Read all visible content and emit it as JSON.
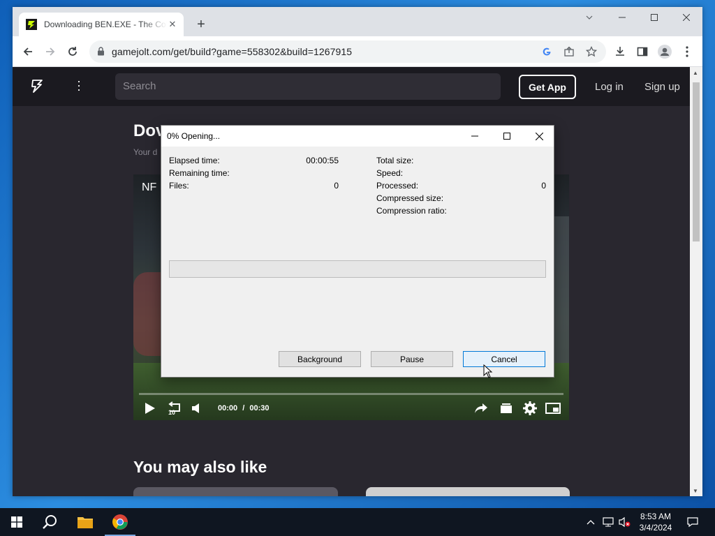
{
  "browser": {
    "tab_title": "Downloading BEN.EXE - The Coll",
    "url": "gamejolt.com/get/build?game=558302&build=1267915"
  },
  "site": {
    "search_placeholder": "Search",
    "get_app": "Get App",
    "log_in": "Log in",
    "sign_up": "Sign up",
    "heading": "Dov",
    "subheading": "Your d",
    "video_overlay_text": "NF",
    "video_time_current": "00:00",
    "video_time_sep": "/",
    "video_time_total": "00:30",
    "rewind_seconds": "10",
    "also_like": "You may also like"
  },
  "dialog": {
    "title": "0% Opening...",
    "left_labels": [
      "Elapsed time:",
      "Remaining time:",
      "Files:"
    ],
    "left_values": [
      "00:00:55",
      "",
      "0"
    ],
    "right_labels": [
      "Total size:",
      "Speed:",
      "Processed:",
      "Compressed size:",
      "Compression ratio:"
    ],
    "right_values": [
      "",
      "",
      "0",
      "",
      ""
    ],
    "progress": 0,
    "buttons": {
      "background": "Background",
      "pause": "Pause",
      "cancel": "Cancel"
    }
  },
  "taskbar": {
    "time": "8:53 AM",
    "date": "3/4/2024"
  },
  "colors": {
    "accent_blue": "#0078d7",
    "site_bg": "#29272f",
    "site_header": "#1b1a20"
  }
}
